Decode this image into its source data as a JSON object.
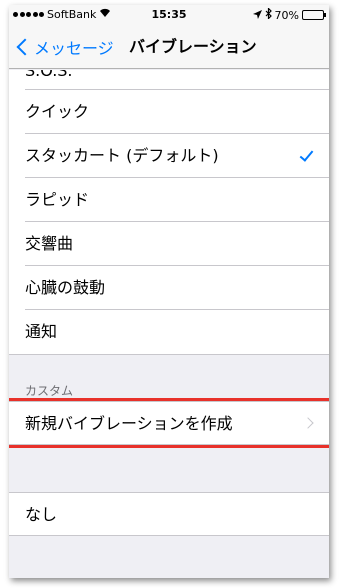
{
  "status_bar": {
    "carrier": "SoftBank",
    "time": "15:35",
    "battery": "70%",
    "battery_level": 0.7
  },
  "nav": {
    "back_label": "メッセージ",
    "title": "バイブレーション"
  },
  "patterns": [
    {
      "label": "S.O.S."
    },
    {
      "label": "クイック"
    },
    {
      "label": "スタッカート (デフォルト)",
      "selected": true
    },
    {
      "label": "ラピッド"
    },
    {
      "label": "交響曲"
    },
    {
      "label": "心臓の鼓動"
    },
    {
      "label": "通知"
    }
  ],
  "custom": {
    "header": "カスタム",
    "create_label": "新規バイブレーションを作成"
  },
  "none_label": "なし",
  "colors": {
    "accent": "#007aff",
    "highlight": "#e8312a",
    "background": "#efeff4"
  }
}
